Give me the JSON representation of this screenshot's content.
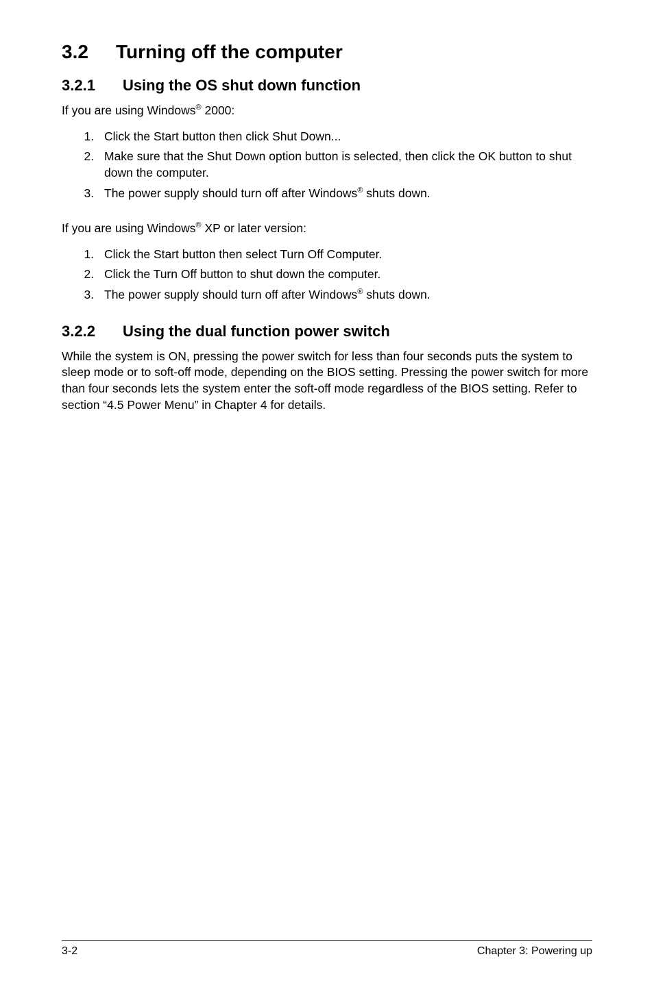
{
  "section": {
    "number": "3.2",
    "title": "Turning off the computer"
  },
  "sub1": {
    "number": "3.2.1",
    "title": "Using the OS shut down function",
    "intro1_pre": "If you are using Windows",
    "intro1_sup": "®",
    "intro1_post": " 2000:",
    "list1": {
      "item1": "Click the Start button then click Shut Down...",
      "item2": "Make sure that the Shut Down option button is selected, then click the OK button to shut down the computer.",
      "item3_pre": "The power supply should turn off after Windows",
      "item3_sup": "®",
      "item3_post": " shuts down."
    },
    "intro2_pre": "If you are using Windows",
    "intro2_sup": "®",
    "intro2_post": " XP or later version:",
    "list2": {
      "item1": "Click the Start button then select Turn Off Computer.",
      "item2": "Click the Turn Off button to shut down the computer.",
      "item3_pre": "The power supply should turn off after Windows",
      "item3_sup": "®",
      "item3_post": " shuts down."
    }
  },
  "sub2": {
    "number": "3.2.2",
    "title": "Using the dual function power switch",
    "para": "While the system is ON, pressing the power switch for less than four seconds puts the system to sleep mode or to soft-off mode, depending on the BIOS setting. Pressing the power switch for more than four seconds lets the system enter the soft-off mode regardless of the BIOS setting. Refer to section  “4.5  Power Menu” in Chapter 4 for details."
  },
  "footer": {
    "left": "3-2",
    "right": "Chapter 3: Powering up"
  }
}
